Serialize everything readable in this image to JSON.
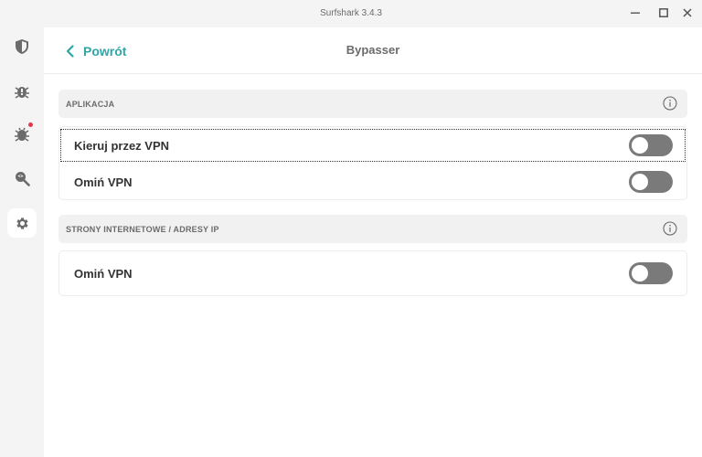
{
  "window": {
    "title": "Surfshark 3.4.3",
    "controls": [
      "minimize-icon",
      "maximize-icon",
      "close-icon"
    ]
  },
  "sidebar": {
    "items": [
      {
        "icon": "shield-icon",
        "active": false
      },
      {
        "icon": "alert-bug-icon",
        "active": false
      },
      {
        "icon": "virus-icon",
        "active": false,
        "notification": true
      },
      {
        "icon": "search-privacy-icon",
        "active": false
      },
      {
        "icon": "gear-icon",
        "active": true
      }
    ]
  },
  "header": {
    "back_label": "Powrót",
    "title": "Bypasser"
  },
  "sections": [
    {
      "label": "APLIKACJA",
      "rows": [
        {
          "label": "Kieruj przez VPN",
          "enabled": false,
          "focused": true
        },
        {
          "label": "Omiń VPN",
          "enabled": false,
          "focused": false
        }
      ]
    },
    {
      "label": "STRONY INTERNETOWE / ADRESY IP",
      "rows": [
        {
          "label": "Omiń VPN",
          "enabled": false,
          "focused": false
        }
      ]
    }
  ],
  "colors": {
    "accent": "#2fa6a6",
    "toggle_off": "#7a7a7a",
    "notification": "#e8344e"
  }
}
